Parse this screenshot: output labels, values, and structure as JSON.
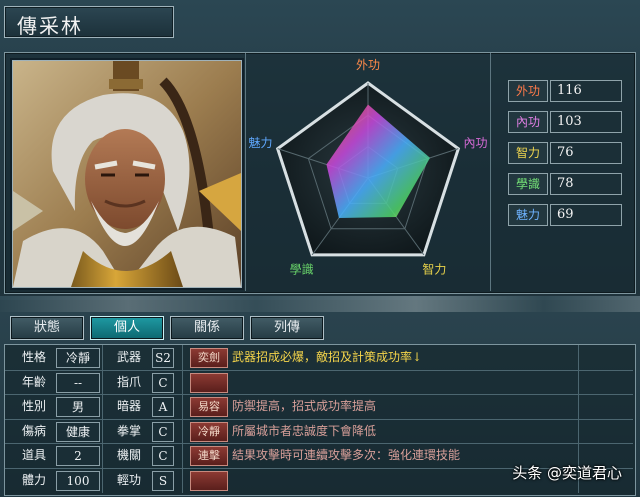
{
  "character": {
    "name": "傳采林"
  },
  "radar": {
    "axes": [
      {
        "label": "外功",
        "color": "#ff8a4a",
        "value": 116
      },
      {
        "label": "內功",
        "color": "#d86bd8",
        "value": 103
      },
      {
        "label": "智力",
        "color": "#e8d24a",
        "value": 76
      },
      {
        "label": "學識",
        "color": "#69d46a",
        "value": 78
      },
      {
        "label": "魅力",
        "color": "#5fa8ff",
        "value": 69
      }
    ]
  },
  "stats": [
    {
      "label": "外功",
      "value": "116",
      "label_color": "#ff7a4a"
    },
    {
      "label": "內功",
      "value": "103",
      "label_color": "#e07fe4"
    },
    {
      "label": "智力",
      "value": "76",
      "label_color": "#f0d64f"
    },
    {
      "label": "學識",
      "value": "78",
      "label_color": "#74e076"
    },
    {
      "label": "魅力",
      "value": "69",
      "label_color": "#6fb3ff"
    }
  ],
  "tabs": [
    {
      "label": "狀態",
      "active": false
    },
    {
      "label": "個人",
      "active": true
    },
    {
      "label": "關係",
      "active": false
    },
    {
      "label": "列傳",
      "active": false
    }
  ],
  "attributes": [
    {
      "label": "性格",
      "value": "冷靜"
    },
    {
      "label": "年齡",
      "value": "--"
    },
    {
      "label": "性別",
      "value": "男"
    },
    {
      "label": "傷病",
      "value": "健康"
    },
    {
      "label": "道具",
      "value": "2"
    },
    {
      "label": "體力",
      "value": "100"
    }
  ],
  "weapons": [
    {
      "label": "武器",
      "grade": "S2"
    },
    {
      "label": "指爪",
      "grade": "C"
    },
    {
      "label": "暗器",
      "grade": "A"
    },
    {
      "label": "拳掌",
      "grade": "C"
    },
    {
      "label": "機關",
      "grade": "C"
    },
    {
      "label": "輕功",
      "grade": "S"
    }
  ],
  "skills": [
    {
      "tag": "奕劍",
      "desc": "武器招成必爆，敵招及計策成功率↓",
      "desc_color": "#f4d44a"
    },
    {
      "tag": "",
      "desc": "",
      "desc_color": "#f4d44a"
    },
    {
      "tag": "易容",
      "desc": "防禦提高，招式成功率提高",
      "desc_color": "#d9a09a"
    },
    {
      "tag": "冷靜",
      "desc": "所屬城市者忠誠度下會降低",
      "desc_color": "#d9a09a"
    },
    {
      "tag": "連擊",
      "desc": "結果攻擊時可連續攻擊多次：強化連環技能",
      "desc_color": "#d9a09a"
    },
    {
      "tag": "",
      "desc": "",
      "desc_color": "#d9a09a"
    }
  ],
  "watermark": "头条 @奕道君心"
}
